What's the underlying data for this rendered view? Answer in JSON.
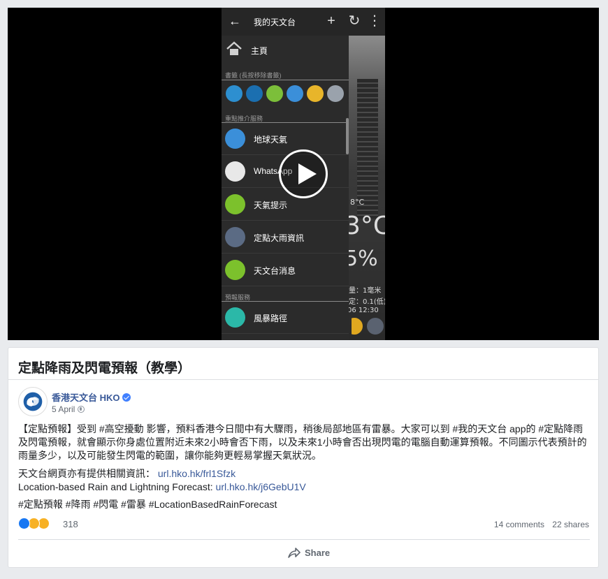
{
  "phone": {
    "title": "我的天文台",
    "home_label": "主頁",
    "bookmarks_label": "書籤 (長按移除書籤)",
    "featured_label": "重點推介服務",
    "forecast_label": "預報服務",
    "menu_items": [
      {
        "label": "地球天氣",
        "color": "#3b8fd9"
      },
      {
        "label": "WhatsApp",
        "color": "#e8e8e8"
      },
      {
        "label": "天氣提示",
        "color": "#7cc12c"
      },
      {
        "label": "定點大雨資訊",
        "color": "#5b6b84"
      },
      {
        "label": "天文台消息",
        "color": "#7cc12c"
      },
      {
        "label": "風暴路徑",
        "color": "#2bb8a8"
      }
    ],
    "bookmark_colors": [
      "#2d8fd0",
      "#1b6fb0",
      "#7cbf3a",
      "#3b8fd9",
      "#e8b52a",
      "#9aa2ac"
    ],
    "weather_small": "8°C",
    "weather_temp": "3°C",
    "weather_pct": "5%",
    "weather_line1": "量：1毫米",
    "weather_line2": "定：0.1(低)",
    "weather_line3": "06 12:30"
  },
  "post": {
    "video_title": "定點降雨及閃電預報（教學）",
    "page_name": "香港天文台 HKO",
    "date": "5 April",
    "paragraph1_lines": [
      "【定點預報】受到 #高空擾動 影響，預料香港今日間中有大驟雨，稍後局部地區有雷暴。大家可以到 #我的天文台 app的 #定點降雨",
      "及閃電預報，就會顯示你身處位置附近未來2小時會否下雨，以及未來1小時會否出現閃電的電腦自動運算預報。不同圖示代表預計的",
      "雨量多少，以及可能發生閃電的範圍，讓你能夠更輕易掌握天氣狀況。"
    ],
    "info_label": "天文台網頁亦有提供相關資訊：",
    "info_link": "url.hko.hk/frl1Sfzk",
    "en_label": "Location-based Rain and Lightning Forecast:",
    "en_link": "url.hko.hk/j6GebU1V",
    "hashtags": "#定點預報 #降雨 #閃電 #雷暴 #LocationBasedRainForecast",
    "reaction_count": "318",
    "comments": "14 comments",
    "shares": "22 shares",
    "share_label": "Share"
  },
  "colors": {
    "link": "#385898",
    "like": "#1877f2",
    "wow": "#f7b125"
  }
}
